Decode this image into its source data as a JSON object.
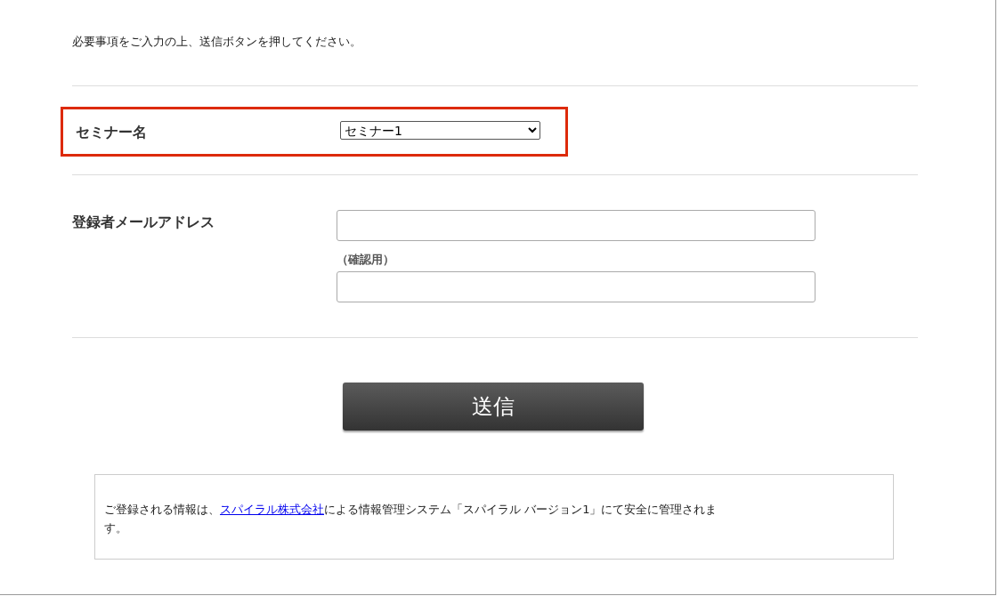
{
  "intro": "必要事項をご入力の上、送信ボタンを押してください。",
  "fields": [
    {
      "kind": "select",
      "label": "セミナー名",
      "value": "セミナー1",
      "highlighted": true
    },
    {
      "kind": "email",
      "label": "登録者メールアドレス",
      "confirm_label": "（確認用）",
      "highlighted": false
    }
  ],
  "submit": "送信",
  "notice": {
    "before": "ご登録される情報は、",
    "link": "スパイラル株式会社",
    "after": "による情報管理システム「スパイラル バージョン1」にて安全に管理されます。"
  }
}
